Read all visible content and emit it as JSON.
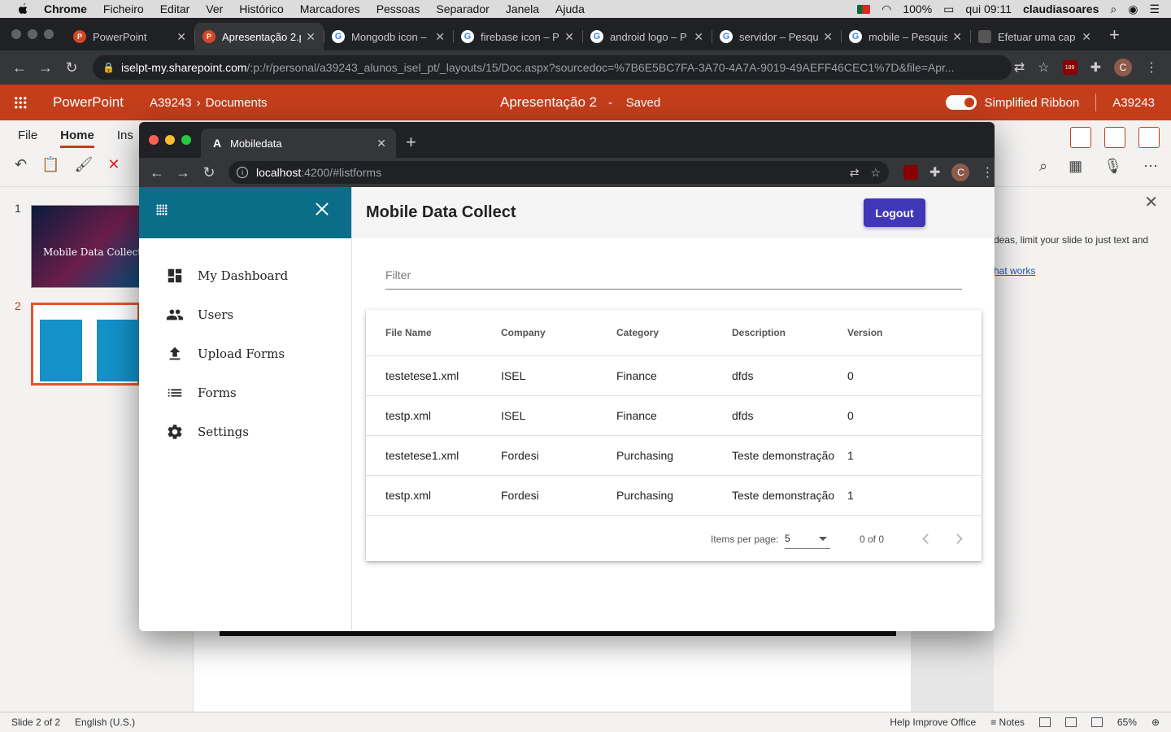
{
  "menubar": {
    "app": "Chrome",
    "items": [
      "Ficheiro",
      "Editar",
      "Ver",
      "Histórico",
      "Marcadores",
      "Pessoas",
      "Separador",
      "Janela",
      "Ajuda"
    ],
    "battery": "100%",
    "clock": "qui 09:11",
    "user": "claudiasoares"
  },
  "outer_browser": {
    "tabs": [
      {
        "title": "PowerPoint",
        "icon": "powerpoint-icon"
      },
      {
        "title": "Apresentação 2.p",
        "icon": "powerpoint-icon",
        "active": true
      },
      {
        "title": "Mongodb icon – ",
        "icon": "google-icon"
      },
      {
        "title": "firebase icon – P",
        "icon": "google-icon"
      },
      {
        "title": "android logo – P",
        "icon": "google-icon"
      },
      {
        "title": "servidor – Pesqu",
        "icon": "google-icon"
      },
      {
        "title": "mobile – Pesquis",
        "icon": "google-icon"
      },
      {
        "title": "Efetuar uma cap",
        "icon": "web-icon"
      }
    ],
    "url_host": "iselpt-my.sharepoint.com",
    "url_path": "/:p:/r/personal/a39243_alunos_isel_pt/_layouts/15/Doc.aspx?sourcedoc=%7B6E5BC7FA-3A70-4A7A-9019-49AEFF46CEC1%7D&file=Apr...",
    "avatar_letter": "C",
    "ext_badge": "189"
  },
  "powerpoint": {
    "app_name": "PowerPoint",
    "breadcrumb_user": "A39243",
    "breadcrumb_folder": "Documents",
    "doc_title": "Apresentação 2",
    "dash": "-",
    "saved_status": "Saved",
    "simplified_ribbon": "Simplified Ribbon",
    "account": "A39243",
    "ribbon_tabs": [
      "File",
      "Home",
      "Ins"
    ],
    "slide1_num": "1",
    "slide2_num": "2",
    "slide1_title": "Mobile Data Collect",
    "ideas_text": "deas, limit your slide to just text and",
    "ideas_link": "hat works",
    "status_slide": "Slide 2 of 2",
    "status_lang": "English (U.S.)",
    "status_help": "Help Improve Office",
    "status_notes": "Notes",
    "zoom": "65%"
  },
  "inner_browser": {
    "tab_title": "Mobiledata",
    "tab_icon_glyph": "A",
    "url_host": "localhost",
    "url_path": ":4200/#listforms",
    "avatar_letter": "C"
  },
  "app": {
    "title": "Mobile Data Collect",
    "logout_label": "Logout",
    "filter_placeholder": "Filter",
    "nav": [
      {
        "label": "My Dashboard",
        "icon": "dashboard-icon"
      },
      {
        "label": "Users",
        "icon": "users-icon"
      },
      {
        "label": "Upload Forms",
        "icon": "upload-icon"
      },
      {
        "label": "Forms",
        "icon": "list-icon"
      },
      {
        "label": "Settings",
        "icon": "gear-icon"
      }
    ],
    "table": {
      "columns": [
        "File Name",
        "Company",
        "Category",
        "Description",
        "Version"
      ],
      "rows": [
        [
          "testetese1.xml",
          "ISEL",
          "Finance",
          "dfds",
          "0"
        ],
        [
          "testp.xml",
          "ISEL",
          "Finance",
          "dfds",
          "0"
        ],
        [
          "testetese1.xml",
          "Fordesi",
          "Purchasing",
          "Teste demonstração",
          "1"
        ],
        [
          "testp.xml",
          "Fordesi",
          "Purchasing",
          "Teste demonstração",
          "1"
        ]
      ]
    },
    "paginator": {
      "label": "Items per page:",
      "page_size": "5",
      "range": "0 of 0"
    }
  },
  "colors": {
    "powerpoint_red": "#c43e1c",
    "sidenav_header": "#0b6e88",
    "logout_button": "#3f36b8"
  }
}
